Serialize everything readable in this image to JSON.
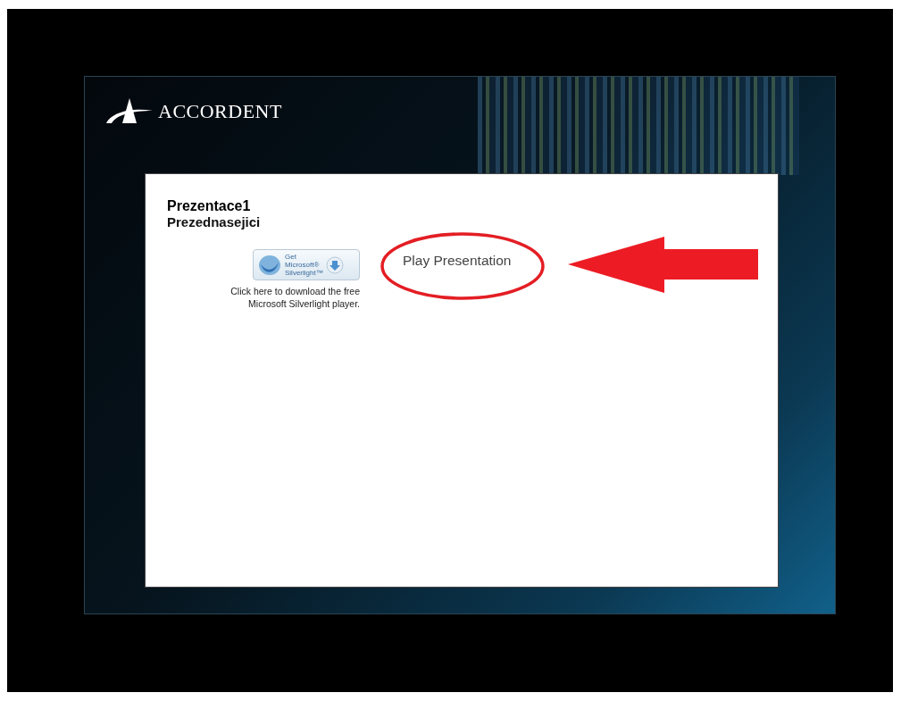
{
  "brand": {
    "name": "ACCORDENT"
  },
  "presentation": {
    "title": "Prezentace1",
    "presenters": "Prezednasejici"
  },
  "silverlight": {
    "badge_lines": [
      "Get",
      "Microsoft®",
      "Silverlight™"
    ],
    "note": "Click here to download the free Microsoft Silverlight player."
  },
  "play_link": "Play Presentation",
  "annotations": {
    "circled": true,
    "arrow": true
  }
}
